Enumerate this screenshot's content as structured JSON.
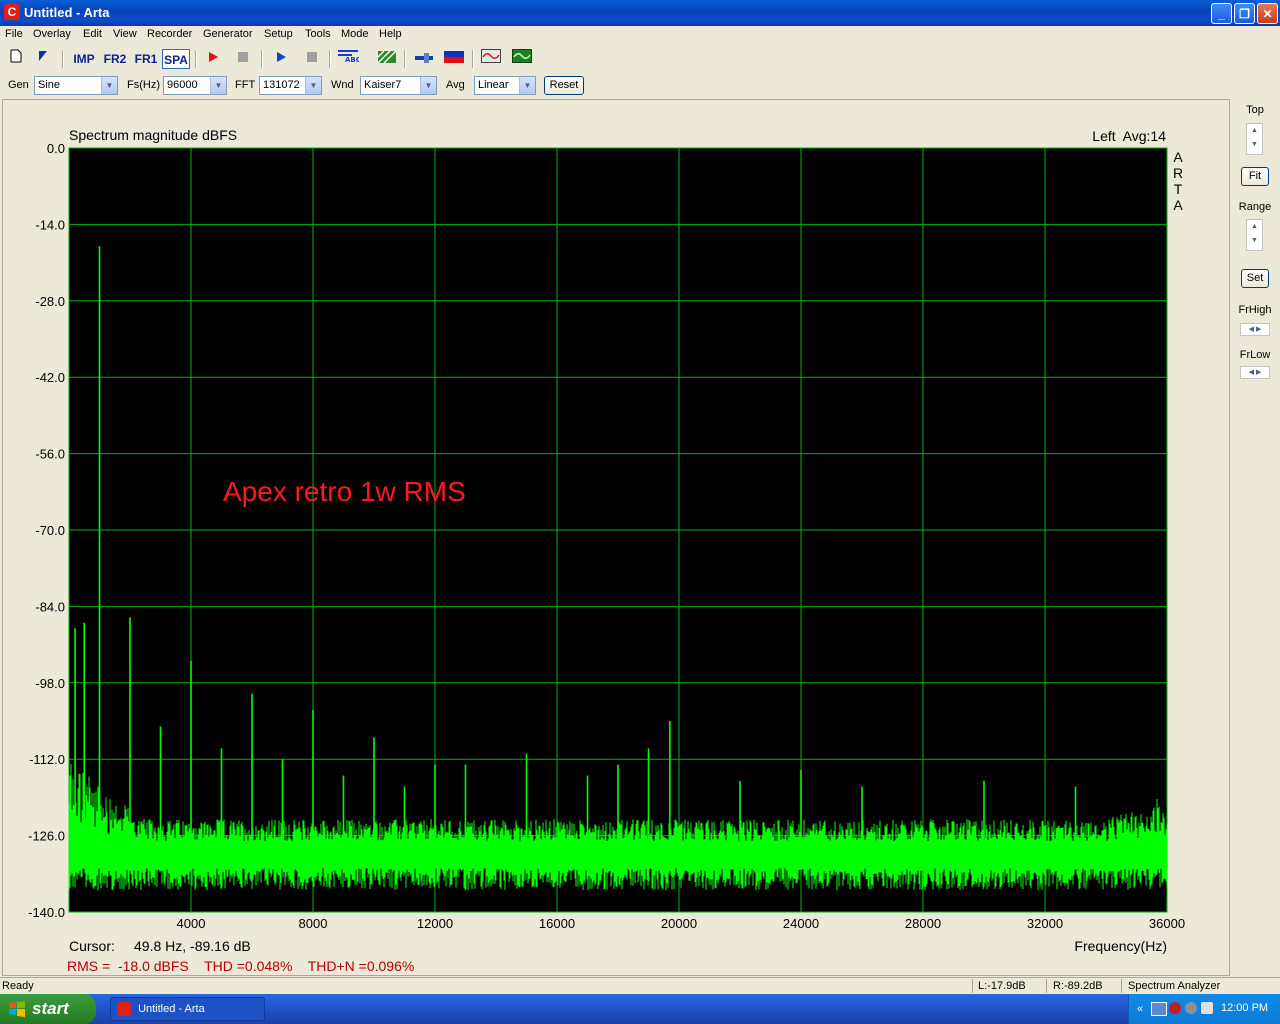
{
  "window": {
    "title": "Untitled - Arta",
    "icon": "arta-app-icon"
  },
  "menu": [
    "File",
    "Overlay",
    "Edit",
    "View",
    "Recorder",
    "Generator",
    "Setup",
    "Tools",
    "Mode",
    "Help"
  ],
  "toolbar": {
    "imp": "IMP",
    "fr2": "FR2",
    "fr1": "FR1",
    "spa": "SPA"
  },
  "controls": {
    "gen_label": "Gen",
    "gen_value": "Sine",
    "fs_label": "Fs(Hz)",
    "fs_value": "96000",
    "fft_label": "FFT",
    "fft_value": "131072",
    "wnd_label": "Wnd",
    "wnd_value": "Kaiser7",
    "avg_label": "Avg",
    "avg_value": "Linear",
    "reset_label": "Reset"
  },
  "right_panel": {
    "top_label": "Top",
    "fit_label": "Fit",
    "range_label": "Range",
    "set_label": "Set",
    "frhigh_label": "FrHigh",
    "frlow_label": "FrLow"
  },
  "plot": {
    "header_left": "Spectrum magnitude dBFS",
    "header_right": "Left  Avg:14",
    "side_text": [
      "A",
      "R",
      "T",
      "A"
    ],
    "annotation": "Apex retro 1w RMS",
    "cursor_label": "Cursor:",
    "cursor_value": "49.8 Hz, -89.16 dB",
    "xlabel": "Frequency(Hz)",
    "measurements": "RMS =  -18.0 dBFS    THD =0.048%    THD+N =0.096%",
    "colors": {
      "background": "#000000",
      "grid": "#00b400",
      "trace": "#00ff00",
      "annotation": "#ff1a1a",
      "measurements": "#b40000"
    }
  },
  "chart_data": {
    "type": "line",
    "title": "Spectrum magnitude dBFS",
    "xlabel": "Frequency(Hz)",
    "ylabel": "",
    "xlim": [
      0,
      36000
    ],
    "ylim": [
      -140,
      0
    ],
    "x_ticks": [
      "4000",
      "8000",
      "12000",
      "16000",
      "20000",
      "24000",
      "28000",
      "32000",
      "36000"
    ],
    "y_ticks": [
      "0.0",
      "-14.0",
      "-28.0",
      "-42.0",
      "-56.0",
      "-70.0",
      "-84.0",
      "-98.0",
      "-112.0",
      "-126.0",
      "-140.0"
    ],
    "grid": true,
    "noise_floor_db": -130,
    "fundamental": {
      "freq": 1000,
      "db": -18.0
    },
    "peaks": [
      {
        "freq": 200,
        "db": -88
      },
      {
        "freq": 500,
        "db": -87
      },
      {
        "freq": 1000,
        "db": -18
      },
      {
        "freq": 2000,
        "db": -86
      },
      {
        "freq": 3000,
        "db": -106
      },
      {
        "freq": 4000,
        "db": -94
      },
      {
        "freq": 5000,
        "db": -110
      },
      {
        "freq": 6000,
        "db": -100
      },
      {
        "freq": 7000,
        "db": -112
      },
      {
        "freq": 8000,
        "db": -103
      },
      {
        "freq": 9000,
        "db": -115
      },
      {
        "freq": 10000,
        "db": -108
      },
      {
        "freq": 11000,
        "db": -117
      },
      {
        "freq": 12000,
        "db": -113
      },
      {
        "freq": 13000,
        "db": -113
      },
      {
        "freq": 15000,
        "db": -111
      },
      {
        "freq": 17000,
        "db": -115
      },
      {
        "freq": 18000,
        "db": -113
      },
      {
        "freq": 19000,
        "db": -110
      },
      {
        "freq": 19700,
        "db": -105
      },
      {
        "freq": 22000,
        "db": -116
      },
      {
        "freq": 24000,
        "db": -114
      },
      {
        "freq": 26000,
        "db": -117
      },
      {
        "freq": 30000,
        "db": -116
      },
      {
        "freq": 33000,
        "db": -117
      }
    ]
  },
  "status": {
    "ready": "Ready",
    "left_level": "L:-17.9dB",
    "right_level": "R:-89.2dB",
    "mode": "Spectrum Analyzer"
  },
  "taskbar": {
    "start": "start",
    "task": "Untitled - Arta",
    "clock": "12:00 PM"
  }
}
